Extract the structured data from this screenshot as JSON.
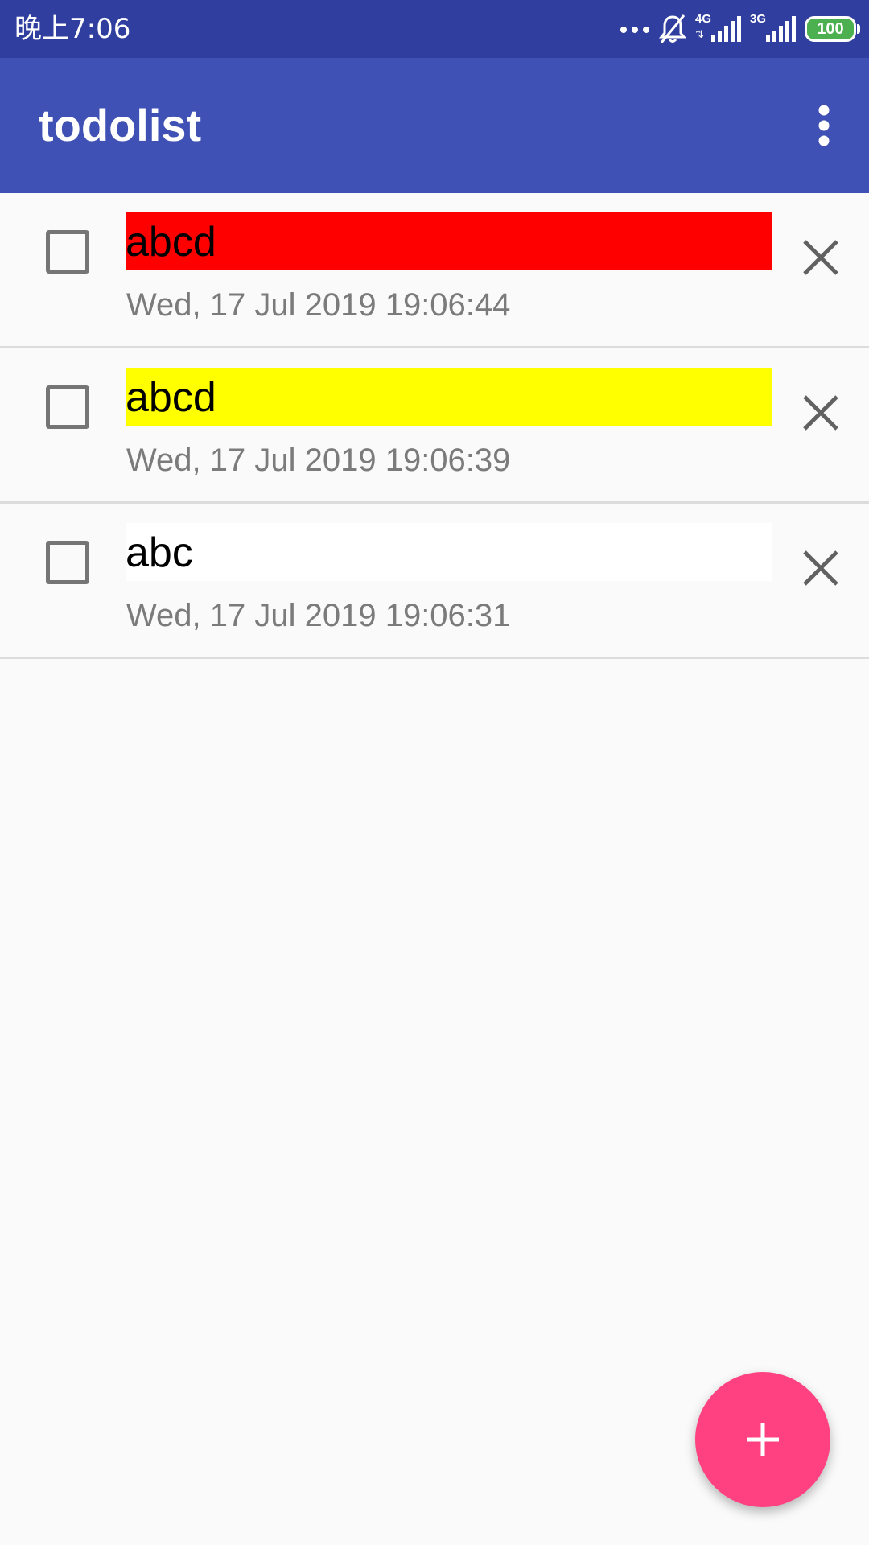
{
  "status_bar": {
    "time": "晚上7:06",
    "network_1": "4G",
    "network_2": "3G",
    "battery": "100",
    "icons": [
      "more-dots-icon",
      "bell-muted-icon",
      "signal-4g-icon",
      "signal-3g-icon",
      "battery-icon"
    ]
  },
  "app_bar": {
    "title": "todolist",
    "overflow_icon": "more-vertical-icon"
  },
  "todos": [
    {
      "title": "abcd",
      "timestamp": "Wed, 17 Jul 2019 19:06:44",
      "highlight_color": "#ff0000",
      "checked": false
    },
    {
      "title": "abcd",
      "timestamp": "Wed, 17 Jul 2019 19:06:39",
      "highlight_color": "#ffff00",
      "checked": false
    },
    {
      "title": "abc",
      "timestamp": "Wed, 17 Jul 2019 19:06:31",
      "highlight_color": "#ffffff",
      "checked": false
    }
  ],
  "fab": {
    "icon": "plus-icon"
  },
  "colors": {
    "status_bar": "#303f9f",
    "app_bar": "#3f51b5",
    "accent": "#ff4081",
    "background": "#fafafa"
  }
}
